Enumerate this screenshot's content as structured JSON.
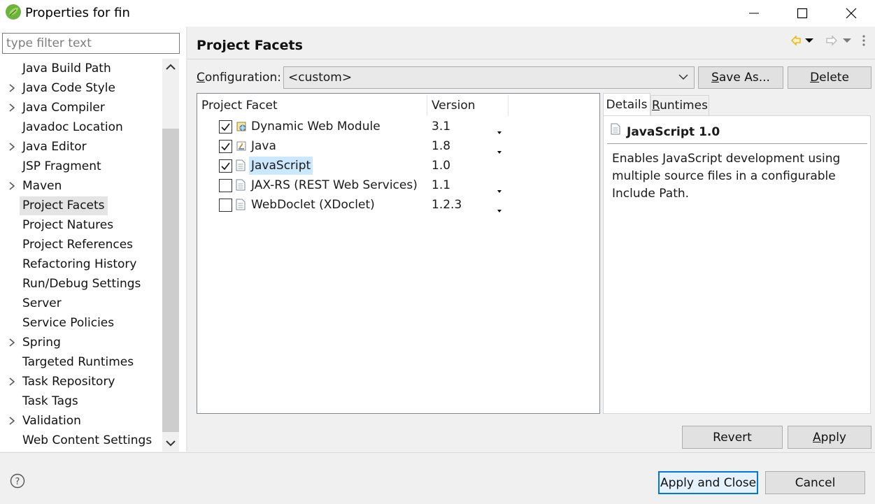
{
  "window": {
    "title": "Properties for fin",
    "icons": {
      "app": "spring-leaf-icon",
      "minimize": "minimize-icon",
      "maximize": "maximize-icon",
      "close": "close-icon"
    }
  },
  "sidebar": {
    "filter_placeholder": "type filter text",
    "items": [
      {
        "label": "Java Build Path",
        "expandable": false
      },
      {
        "label": "Java Code Style",
        "expandable": true
      },
      {
        "label": "Java Compiler",
        "expandable": true
      },
      {
        "label": "Javadoc Location",
        "expandable": false
      },
      {
        "label": "Java Editor",
        "expandable": true
      },
      {
        "label": "JSP Fragment",
        "expandable": false
      },
      {
        "label": "Maven",
        "expandable": true
      },
      {
        "label": "Project Facets",
        "expandable": false,
        "selected": true
      },
      {
        "label": "Project Natures",
        "expandable": false
      },
      {
        "label": "Project References",
        "expandable": false
      },
      {
        "label": "Refactoring History",
        "expandable": false
      },
      {
        "label": "Run/Debug Settings",
        "expandable": false
      },
      {
        "label": "Server",
        "expandable": false
      },
      {
        "label": "Service Policies",
        "expandable": false
      },
      {
        "label": "Spring",
        "expandable": true
      },
      {
        "label": "Targeted Runtimes",
        "expandable": false
      },
      {
        "label": "Task Repository",
        "expandable": true
      },
      {
        "label": "Task Tags",
        "expandable": false
      },
      {
        "label": "Validation",
        "expandable": true
      },
      {
        "label": "Web Content Settings",
        "expandable": false
      }
    ]
  },
  "main": {
    "title": "Project Facets",
    "configuration_label": "Configuration:",
    "configuration_value": "<custom>",
    "save_as_label": "Save As...",
    "delete_label": "Delete",
    "table": {
      "headers": [
        "Project Facet",
        "Version"
      ],
      "rows": [
        {
          "checked": true,
          "icon": "dynamic-web-module-icon",
          "name": "Dynamic Web Module",
          "version": "3.1",
          "has_dropdown": true,
          "selected": false
        },
        {
          "checked": true,
          "icon": "java-facet-icon",
          "name": "Java",
          "version": "1.8",
          "has_dropdown": true,
          "selected": false
        },
        {
          "checked": true,
          "icon": "document-icon",
          "name": "JavaScript",
          "version": "1.0",
          "has_dropdown": false,
          "selected": true
        },
        {
          "checked": false,
          "icon": "document-icon",
          "name": "JAX-RS (REST Web Services)",
          "version": "1.1",
          "has_dropdown": true,
          "selected": false
        },
        {
          "checked": false,
          "icon": "document-icon",
          "name": "WebDoclet (XDoclet)",
          "version": "1.2.3",
          "has_dropdown": true,
          "selected": false
        }
      ]
    },
    "details": {
      "tabs": [
        "Details",
        "Runtimes"
      ],
      "active_tab": "Details",
      "heading": "JavaScript 1.0",
      "description": "Enables JavaScript development using multiple source files in a configurable Include Path."
    },
    "revert_label": "Revert",
    "apply_label": "Apply"
  },
  "footer": {
    "apply_close_label": "Apply and Close",
    "cancel_label": "Cancel"
  },
  "colors": {
    "selection": "#cce8ff",
    "default_button_border": "#0078d7",
    "nav_back_arrow": "#e8b000"
  }
}
